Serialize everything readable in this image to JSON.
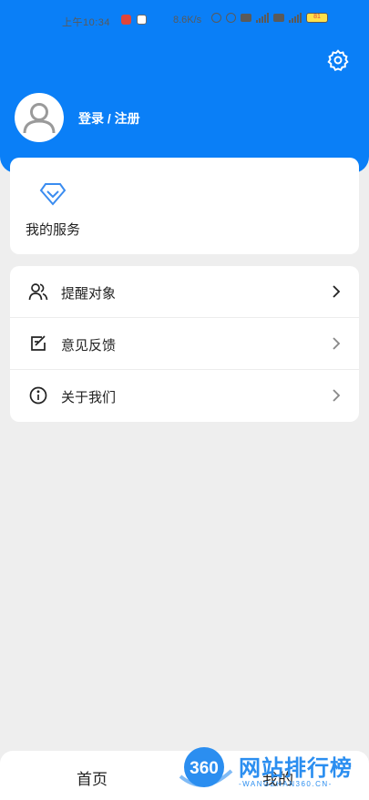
{
  "status_bar": {
    "time": "上午10:34",
    "net_speed": "8.6K/s",
    "battery": "81"
  },
  "header": {
    "login_label": "登录 / 注册",
    "bg_color": "#0a7ff7"
  },
  "services": {
    "title": "我的服务",
    "icon": "diamond-icon"
  },
  "menu": [
    {
      "label": "提醒对象",
      "icon": "people-icon"
    },
    {
      "label": "意见反馈",
      "icon": "edit-icon"
    },
    {
      "label": "关于我们",
      "icon": "info-icon"
    }
  ],
  "tabs": [
    {
      "label": "首页"
    },
    {
      "label": "我的"
    }
  ],
  "watermark": {
    "logo_text": "360",
    "title": "网站排行榜",
    "subtitle": "-WANGZHAN360.CN-"
  }
}
